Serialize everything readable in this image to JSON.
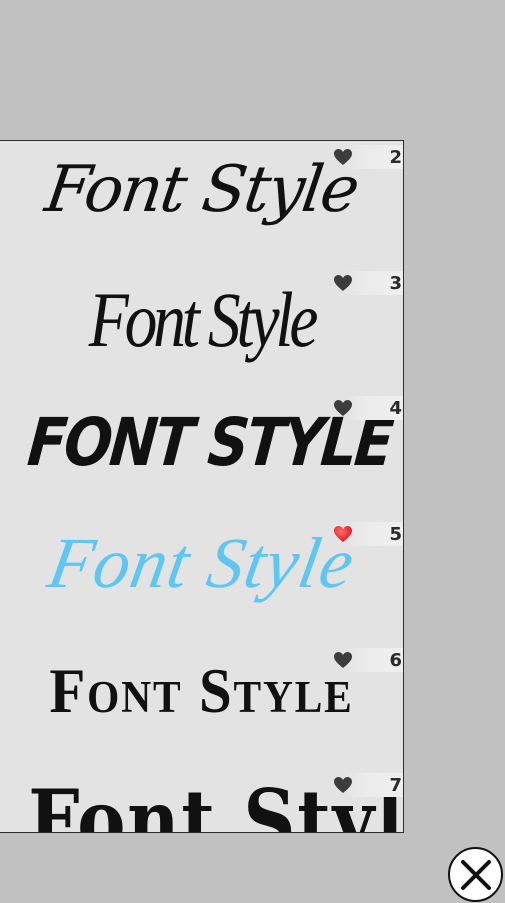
{
  "font_list": {
    "items": [
      {
        "number": "2",
        "sample": "Font Style",
        "favorite": false
      },
      {
        "number": "3",
        "sample": "Font Style",
        "favorite": false
      },
      {
        "number": "4",
        "sample": "Font Style",
        "favorite": false
      },
      {
        "number": "5",
        "sample": "Font Style",
        "favorite": true
      },
      {
        "number": "6",
        "sample": "Font Style",
        "favorite": false
      },
      {
        "number": "7",
        "sample": "Font Style",
        "favorite": false
      }
    ]
  },
  "colors": {
    "background": "#c1c1c1",
    "panel": "#e3e3e3",
    "heart_inactive": "#3c3c3c",
    "heart_active": "#d9141b",
    "highlight_sample": "#5fc6f3"
  },
  "icons": {
    "favorite": "heart-icon",
    "close": "close-icon"
  }
}
